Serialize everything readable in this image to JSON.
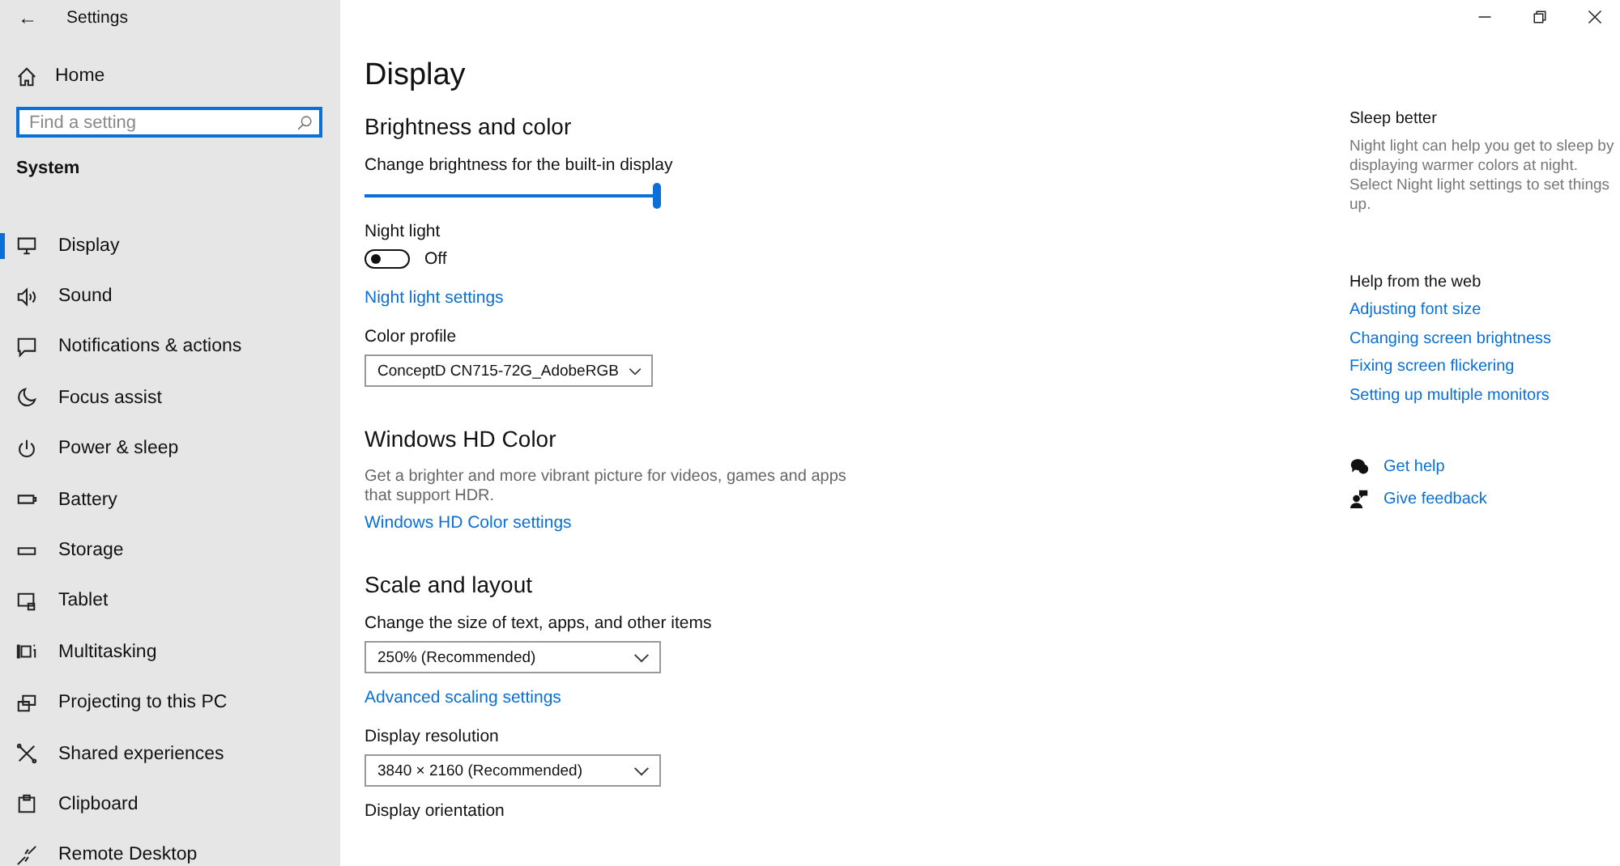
{
  "window": {
    "title": "Settings",
    "back": "←"
  },
  "sidebar": {
    "home": "Home",
    "search": {
      "placeholder": "Find a setting"
    },
    "section": "System",
    "items": [
      {
        "label": "Display",
        "selected": true
      },
      {
        "label": "Sound",
        "selected": false
      },
      {
        "label": "Notifications & actions",
        "selected": false
      },
      {
        "label": "Focus assist",
        "selected": false
      },
      {
        "label": "Power & sleep",
        "selected": false
      },
      {
        "label": "Battery",
        "selected": false
      },
      {
        "label": "Storage",
        "selected": false
      },
      {
        "label": "Tablet",
        "selected": false
      },
      {
        "label": "Multitasking",
        "selected": false
      },
      {
        "label": "Projecting to this PC",
        "selected": false
      },
      {
        "label": "Shared experiences",
        "selected": false
      },
      {
        "label": "Clipboard",
        "selected": false
      },
      {
        "label": "Remote Desktop",
        "selected": false
      }
    ]
  },
  "page": {
    "title": "Display",
    "sections": [
      {
        "heading": "Brightness and color",
        "items": [
          {
            "kind": "slider",
            "label": "Change brightness for the built-in display",
            "level": 1.0
          },
          {
            "kind": "toggle",
            "label": "Night light",
            "on": false,
            "state": "Off"
          },
          {
            "kind": "link",
            "label": "Night light settings"
          },
          {
            "kind": "dropdown",
            "label": "Color profile",
            "value": "ConceptD CN715-72G_AdobeRGB"
          }
        ]
      },
      {
        "heading": "Windows HD Color",
        "items": [
          {
            "kind": "text",
            "label": "Get a brighter and more vibrant picture for videos, games and apps that support HDR."
          },
          {
            "kind": "link",
            "label": "Windows HD Color settings"
          }
        ]
      },
      {
        "heading": "Scale and layout",
        "items": [
          {
            "kind": "dropdown",
            "label": "Change the size of text, apps, and other items",
            "value": "250% (Recommended)"
          },
          {
            "kind": "link",
            "label": "Advanced scaling settings"
          },
          {
            "kind": "dropdown",
            "label": "Display resolution",
            "value": "3840 × 2160 (Recommended)"
          },
          {
            "kind": "label",
            "label": "Display orientation"
          }
        ]
      }
    ]
  },
  "aside": {
    "tip_title": "Sleep better",
    "tip": "Night light can help you get to sleep by displaying warmer colors at night. Select Night light settings to set things up.",
    "help_title": "Help from the web",
    "links": [
      "Adjusting font size",
      "Changing screen brightness",
      "Fixing screen flickering",
      "Setting up multiple monitors"
    ],
    "actions": [
      "Get help",
      "Give feedback"
    ]
  }
}
